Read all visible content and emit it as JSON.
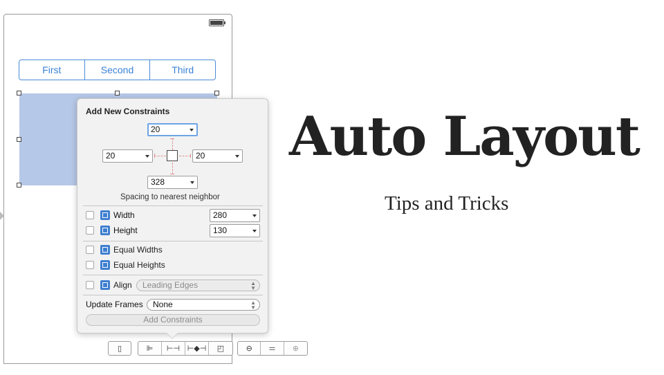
{
  "canvas": {
    "segmented_control": {
      "segments": [
        "First",
        "Second",
        "Third"
      ]
    }
  },
  "popover": {
    "title": "Add New Constraints",
    "spacing": {
      "top": "20",
      "left": "20",
      "right": "20",
      "bottom": "328"
    },
    "spacing_caption": "Spacing to nearest neighbor",
    "width": {
      "label": "Width",
      "value": "280"
    },
    "height": {
      "label": "Height",
      "value": "130"
    },
    "equal_widths": "Equal Widths",
    "equal_heights": "Equal Heights",
    "align": {
      "label": "Align",
      "value": "Leading Edges"
    },
    "update_frames": {
      "label": "Update Frames",
      "value": "None"
    },
    "add_button": "Add Constraints"
  },
  "toolbar": {
    "left_group": [
      "phone-icon"
    ],
    "middle_group": [
      "align-icon",
      "pin-icon",
      "resolve-icon",
      "resize-icon"
    ],
    "zoom_group": [
      "zoom-out-icon",
      "zoom-actual-icon",
      "zoom-in-icon"
    ]
  },
  "headline": {
    "title": "Auto Layout",
    "subtitle": "Tips and Tricks"
  },
  "colors": {
    "accent_blue": "#3a82d6",
    "selection_fill": "#b6c8e7",
    "constraint_red": "#e09090",
    "icon_blue": "#3f7fd0"
  }
}
